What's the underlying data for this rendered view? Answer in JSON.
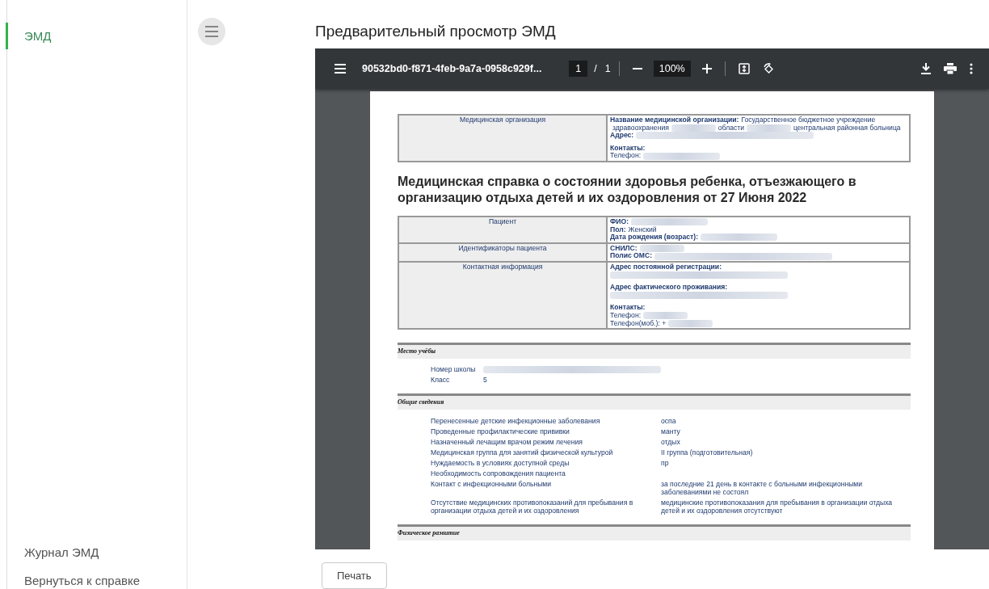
{
  "sidebar": {
    "items": [
      {
        "label": "ЭМД",
        "selected": true
      }
    ],
    "footer_links": [
      "Журнал ЭМД",
      "Вернуться к справке"
    ]
  },
  "page_title": "Предварительный просмотр ЭМД",
  "viewer": {
    "file_name": "90532bd0-f871-4feb-9a7a-0958c929f...",
    "page_current": "1",
    "page_separator": "/",
    "page_total": "1",
    "zoom": "100%"
  },
  "document": {
    "org_table": [
      {
        "label": "Медицинская организация",
        "groups": [
          [
            {
              "label": "Название медицинской организации:",
              "parts": [
                {
                  "kind": "text",
                  "text": "Государственное бюджетное учреждение"
                },
                {
                  "kind": "text",
                  "text": "здравоохранения"
                },
                {
                  "kind": "redacted_short"
                },
                {
                  "kind": "text",
                  "text": "области"
                },
                {
                  "kind": "redacted_short"
                },
                {
                  "kind": "text",
                  "text": "центральная районная больница"
                }
              ]
            },
            {
              "label": "Адрес:",
              "parts": [
                {
                  "kind": "redacted_long"
                }
              ]
            }
          ],
          [
            {
              "label": "Контакты:"
            },
            {
              "parts": [
                {
                  "kind": "text",
                  "text": "Телефон:"
                },
                {
                  "kind": "redacted_medium"
                }
              ]
            }
          ]
        ]
      }
    ],
    "heading": "Медицинская справка о состоянии здоровья ребенка, отъезжающего в организацию отдыха детей и их оздоровления от 27 Июня 2022",
    "patient_table": [
      {
        "label": "Пациент",
        "groups": [
          [
            {
              "label": "ФИО:",
              "parts": [
                {
                  "kind": "redacted_medium"
                }
              ]
            },
            {
              "label": "Пол:",
              "parts": [
                {
                  "kind": "text",
                  "text": "Женский"
                }
              ]
            },
            {
              "label": "Дата рождения (возраст):",
              "parts": [
                {
                  "kind": "redacted_medium"
                }
              ]
            }
          ]
        ]
      },
      {
        "label": "Идентификаторы пациента",
        "groups": [
          [
            {
              "label": "СНИЛС:",
              "parts": [
                {
                  "kind": "redacted_short"
                }
              ]
            },
            {
              "label": "Полис ОМС:",
              "parts": [
                {
                  "kind": "redacted_long"
                }
              ]
            }
          ]
        ]
      },
      {
        "label": "Контактная информация",
        "groups": [
          [
            {
              "label": "Адрес постоянной регистрации:"
            },
            {
              "parts": [
                {
                  "kind": "redacted_long"
                }
              ]
            }
          ],
          [
            {
              "label": "Адрес фактического проживания:"
            },
            {
              "parts": [
                {
                  "kind": "redacted_long"
                }
              ]
            }
          ],
          [
            {
              "label": "Контакты:"
            },
            {
              "parts": [
                {
                  "kind": "text",
                  "text": "Телефон:"
                },
                {
                  "kind": "redacted_short"
                }
              ]
            },
            {
              "parts": [
                {
                  "kind": "text",
                  "text": "Телефон(моб.): +"
                },
                {
                  "kind": "redacted_short"
                }
              ]
            }
          ]
        ]
      }
    ],
    "sections": [
      {
        "title": "Место учёбы",
        "kind": "compact",
        "rows": [
          {
            "label": "Номер школы",
            "parts": [
              {
                "kind": "redacted_long"
              }
            ]
          },
          {
            "label": "Класс",
            "parts": [
              {
                "kind": "text",
                "text": "5"
              }
            ]
          }
        ]
      },
      {
        "title": "Общие сведения",
        "kind": "wide",
        "rows": [
          {
            "label": "Перенесенные детские инфекционные заболевания",
            "parts": [
              {
                "kind": "text",
                "text": "оспа"
              }
            ]
          },
          {
            "label": "Проведенные профилактические прививки",
            "parts": [
              {
                "kind": "text",
                "text": "манту"
              }
            ]
          },
          {
            "label": "Назначенный лечащим врачом режим лечения",
            "parts": [
              {
                "kind": "text",
                "text": "отдых"
              }
            ]
          },
          {
            "label": "Медицинская группа для занятий физической культурой",
            "parts": [
              {
                "kind": "text",
                "text": "II группа (подготовительная)"
              }
            ]
          },
          {
            "label": "Нуждаемость в условиях доступной среды",
            "parts": [
              {
                "kind": "text",
                "text": "пр"
              }
            ]
          },
          {
            "label": "Необходимость сопровождения пациента"
          },
          {
            "label": "Контакт с инфекционными больными",
            "parts": [
              {
                "kind": "text",
                "text": "за последние 21 день в контакте с больными инфекционными заболеваниями не состоял"
              }
            ]
          },
          {
            "label": "Отсутствие медицинских противопоказаний для пребывания в организации отдыха детей и их оздоровления",
            "parts": [
              {
                "kind": "text",
                "text": "медицинские противопоказания для пребывания в организации отдыха детей и их оздоровления отсутствуют"
              }
            ]
          }
        ]
      },
      {
        "title": "Физическое развитие",
        "kind": "wide"
      }
    ]
  },
  "print_button": "Печать"
}
